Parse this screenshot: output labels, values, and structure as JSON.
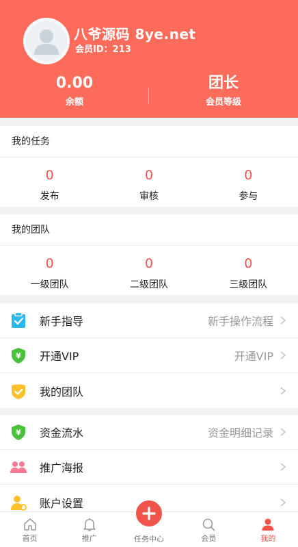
{
  "user": {
    "name": "八爷源码 8ye.net",
    "member_id": "会员ID：213"
  },
  "header_stats": [
    {
      "value": "0.00",
      "label": "余额"
    },
    {
      "value": "团长",
      "label": "会员等级"
    }
  ],
  "tasks": {
    "title": "我的任务",
    "items": [
      {
        "value": "0",
        "label": "发布"
      },
      {
        "value": "0",
        "label": "审核"
      },
      {
        "value": "0",
        "label": "参与"
      }
    ]
  },
  "team": {
    "title": "我的团队",
    "items": [
      {
        "value": "0",
        "label": "一级团队"
      },
      {
        "value": "0",
        "label": "二级团队"
      },
      {
        "value": "0",
        "label": "三级团队"
      }
    ]
  },
  "menu_group_1": [
    {
      "label": "新手指导",
      "extra": "新手操作流程",
      "icon": "clipboard-check-icon"
    },
    {
      "label": "开通VIP",
      "extra": "开通VIP",
      "icon": "shield-yen-icon"
    },
    {
      "label": "我的团队",
      "extra": "",
      "icon": "shield-check-icon"
    }
  ],
  "menu_group_2": [
    {
      "label": "资金流水",
      "extra": "资金明细记录",
      "icon": "shield-yen-icon"
    },
    {
      "label": "推广海报",
      "extra": "",
      "icon": "users-icon"
    },
    {
      "label": "账户设置",
      "extra": "",
      "icon": "user-settings-icon"
    }
  ],
  "tabbar": [
    {
      "label": "首页",
      "icon": "home-icon"
    },
    {
      "label": "推广",
      "icon": "bell-icon"
    },
    {
      "label": "任务中心",
      "icon": "plus-icon"
    },
    {
      "label": "会员",
      "icon": "search-icon"
    },
    {
      "label": "我的",
      "icon": "person-icon",
      "active": true
    }
  ],
  "colors": {
    "header_bg": "#fd6b5a",
    "accent": "#f0544b",
    "cyan_icon": "#2bb8ee",
    "green_icon": "#4cc13c",
    "yellow_icon": "#ffc12b",
    "pink_icon": "#f87a95"
  }
}
